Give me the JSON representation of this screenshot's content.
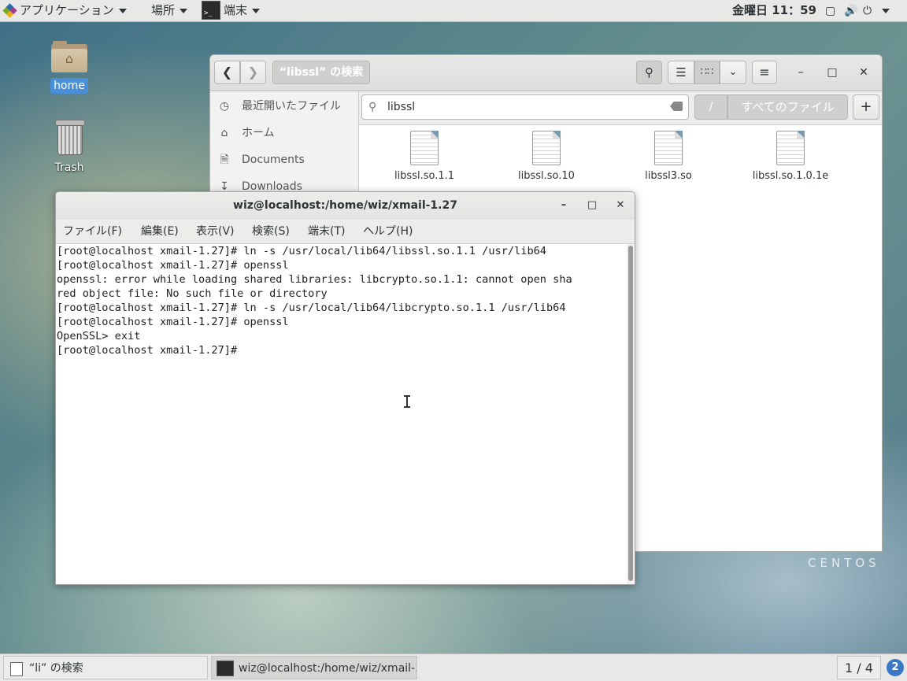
{
  "topbar": {
    "applications_label": "アプリケーション",
    "places_label": "場所",
    "terminal_app_label": "端末",
    "clock": "金曜日 11：59"
  },
  "desktop": {
    "home_label": "home",
    "trash_label": "Trash",
    "branding": "CENTOS"
  },
  "file_manager": {
    "path_label": "“libssl” の検索",
    "sidebar": [
      {
        "label": "最近開いたファイル",
        "icon": "clock-icon"
      },
      {
        "label": "ホーム",
        "icon": "home-icon"
      },
      {
        "label": "Documents",
        "icon": "document-icon"
      },
      {
        "label": "Downloads",
        "icon": "download-icon"
      }
    ],
    "search_text": "libssl",
    "location_slash": "/",
    "location_all": "すべてのファイル",
    "add_label": "+",
    "files": [
      "libssl.so.1.1",
      "libssl.so.10",
      "libssl3.so",
      "libssl.so.1.0.1e"
    ]
  },
  "terminal": {
    "title": "wiz@localhost:/home/wiz/xmail-1.27",
    "menus": [
      "ファイル(F)",
      "編集(E)",
      "表示(V)",
      "検索(S)",
      "端末(T)",
      "ヘルプ(H)"
    ],
    "lines": [
      "[root@localhost xmail-1.27]# ln -s /usr/local/lib64/libssl.so.1.1 /usr/lib64",
      "[root@localhost xmail-1.27]# openssl",
      "openssl: error while loading shared libraries: libcrypto.so.1.1: cannot open sha",
      "red object file: No such file or directory",
      "[root@localhost xmail-1.27]# ln -s /usr/local/lib64/libcrypto.so.1.1 /usr/lib64",
      "[root@localhost xmail-1.27]# openssl",
      "OpenSSL> exit",
      "[root@localhost xmail-1.27]# "
    ]
  },
  "taskbar": {
    "fm_task": "“li” の検索",
    "term_task": "wiz@localhost:/home/wiz/xmail-…",
    "workspace": "1 / 4",
    "notifications": "2"
  }
}
